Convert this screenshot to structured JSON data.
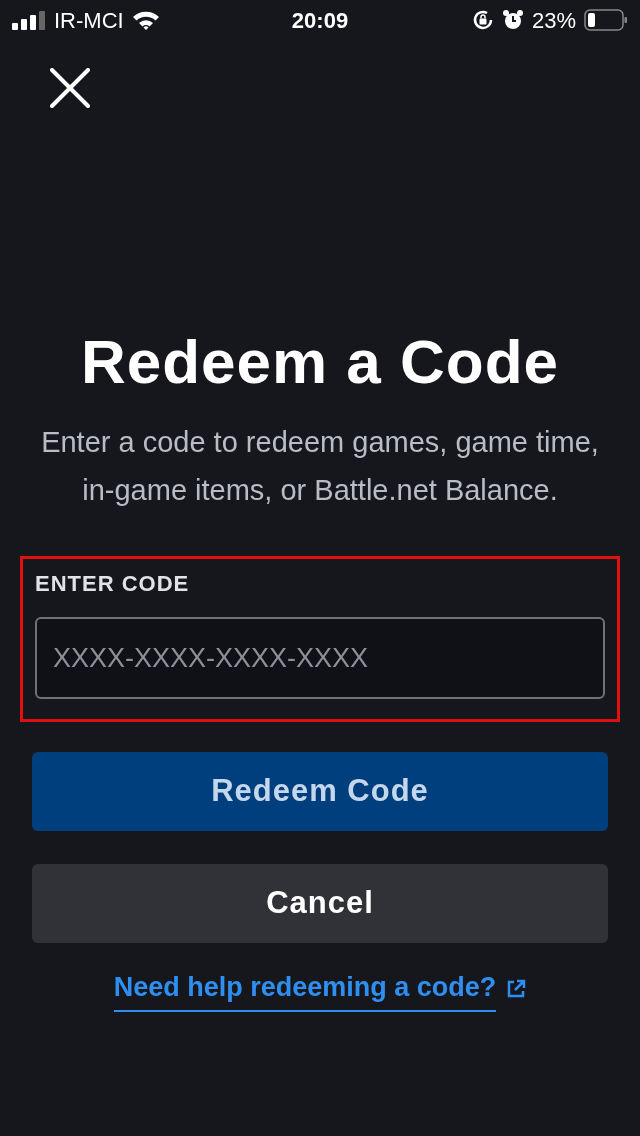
{
  "status_bar": {
    "carrier": "IR-MCI",
    "time": "20:09",
    "battery_percent": "23%"
  },
  "title": "Redeem a Code",
  "description": "Enter a code to redeem games, game time, in-game items, or Battle.net Balance.",
  "code_field": {
    "label": "ENTER CODE",
    "placeholder": "XXXX-XXXX-XXXX-XXXX",
    "highlighted": true
  },
  "buttons": [
    {
      "label": "Redeem Code",
      "kind": "primary"
    },
    {
      "label": "Cancel",
      "kind": "secondary"
    }
  ],
  "help_link": "Need help redeeming a code?"
}
